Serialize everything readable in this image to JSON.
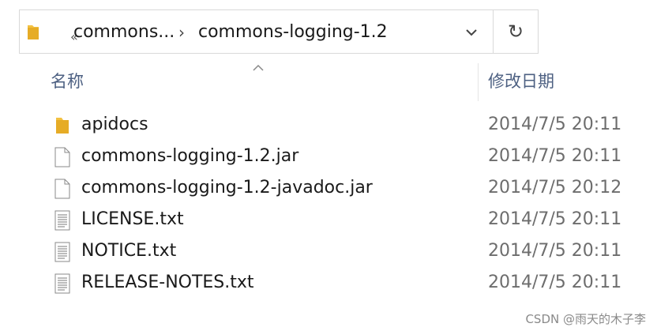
{
  "address_bar": {
    "overflow_glyph": "«",
    "breadcrumbs": [
      {
        "label": "commons..."
      },
      {
        "label": "commons-logging-1.2"
      }
    ],
    "separator": "›",
    "dropdown_icon": "chevron-down-icon",
    "refresh_glyph": "↻"
  },
  "columns": {
    "name": "名称",
    "modified": "修改日期",
    "sorted_column": "name",
    "sort_direction": "ascending"
  },
  "files": [
    {
      "name": "apidocs",
      "date": "2014/7/5 20:11",
      "icon": "folder-icon",
      "type": "folder"
    },
    {
      "name": "commons-logging-1.2.jar",
      "date": "2014/7/5 20:11",
      "icon": "file-icon",
      "type": "file"
    },
    {
      "name": "commons-logging-1.2-javadoc.jar",
      "date": "2014/7/5 20:12",
      "icon": "file-icon",
      "type": "file"
    },
    {
      "name": "LICENSE.txt",
      "date": "2014/7/5 20:11",
      "icon": "text-file-icon",
      "type": "text"
    },
    {
      "name": "NOTICE.txt",
      "date": "2014/7/5 20:11",
      "icon": "text-file-icon",
      "type": "text"
    },
    {
      "name": "RELEASE-NOTES.txt",
      "date": "2014/7/5 20:11",
      "icon": "text-file-icon",
      "type": "text"
    }
  ],
  "watermark": "CSDN @雨天的木子李",
  "colors": {
    "folder_yellow": "#f3c141",
    "header_text": "#4d6082",
    "date_text": "#6d6d6d",
    "border": "#d9d9d9"
  }
}
